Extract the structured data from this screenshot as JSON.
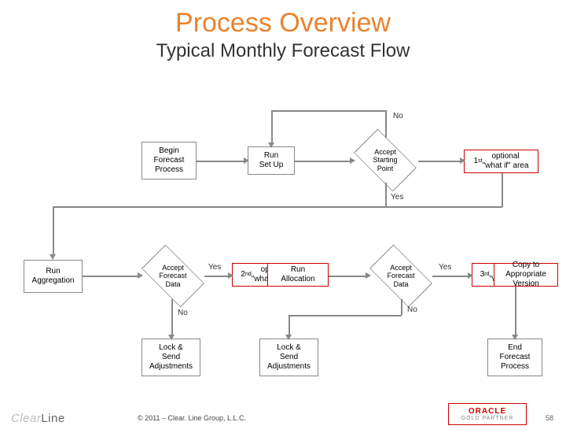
{
  "title": "Process Overview",
  "subtitle": "Typical Monthly Forecast Flow",
  "nodes": {
    "begin": "Begin\nForecast\nProcess",
    "runsetup": "Run\nSet Up",
    "acceptstart": "Accept\nStarting\nPoint",
    "whatif1": "1st optional\n\"what if\" area",
    "runagg": "Run\nAggregation",
    "acceptfc1": "Accept\nForecast\nData",
    "whatif2a": "2nd optional\n\"what if\" area",
    "whatif2b": "Run\nAllocation",
    "acceptfc2": "Accept\nForecast\nData",
    "whatif3a": "3rd optional\n\"what if\" area",
    "whatif3b": "Copy to\nAppropriate\nVersion",
    "lock1": "Lock &\nSend\nAdjustments",
    "lock2": "Lock &\nSend\nAdjustments",
    "end": "End\nForecast\nProcess"
  },
  "labels": {
    "no": "No",
    "yes": "Yes"
  },
  "footer": "© 2011 – Clear. Line Group, L.L.C.",
  "page": "58",
  "logo_left_a": "Clear",
  "logo_left_b": "Line",
  "logo_right_a": "ORACLE",
  "logo_right_b": "GOLD PARTNER"
}
